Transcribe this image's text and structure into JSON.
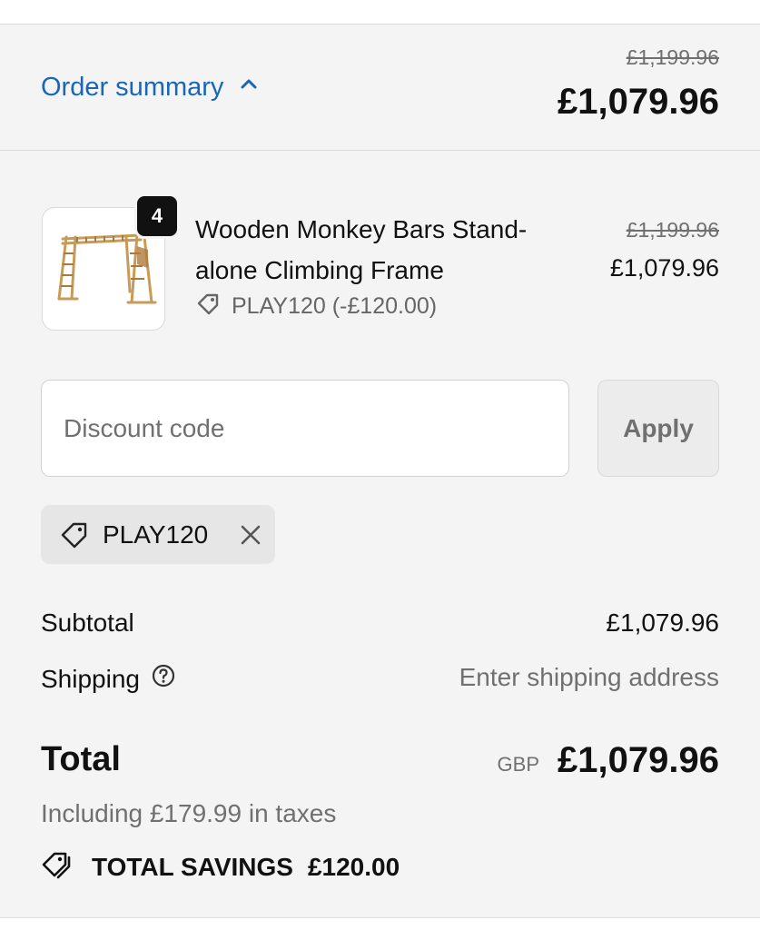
{
  "header": {
    "toggle_label": "Order summary",
    "compare_at_price": "£1,199.96",
    "total_price": "£1,079.96"
  },
  "line_item": {
    "quantity": "4",
    "title": "Wooden Monkey Bars Stand-alone Climbing Frame",
    "discount": "PLAY120 (-£120.00)",
    "compare_at_price": "£1,199.96",
    "price": "£1,079.96"
  },
  "discount_form": {
    "placeholder": "Discount code",
    "value": "",
    "apply_label": "Apply"
  },
  "applied_code": {
    "code": "PLAY120"
  },
  "totals": {
    "subtotal_label": "Subtotal",
    "subtotal_value": "£1,079.96",
    "shipping_label": "Shipping",
    "shipping_value": "Enter shipping address",
    "total_label": "Total",
    "currency": "GBP",
    "total_value": "£1,079.96",
    "taxes_note": "Including £179.99 in taxes",
    "savings_label": "TOTAL SAVINGS",
    "savings_value": "£120.00"
  },
  "icons": {
    "toggle": "chevron-up-icon",
    "discount_tag": "tag-icon",
    "remove": "close-icon",
    "help": "question-circle-icon",
    "savings": "tags-icon"
  },
  "colors": {
    "link": "#1767b8",
    "panel_background": "#f4f4f4",
    "muted_text": "#707070"
  }
}
